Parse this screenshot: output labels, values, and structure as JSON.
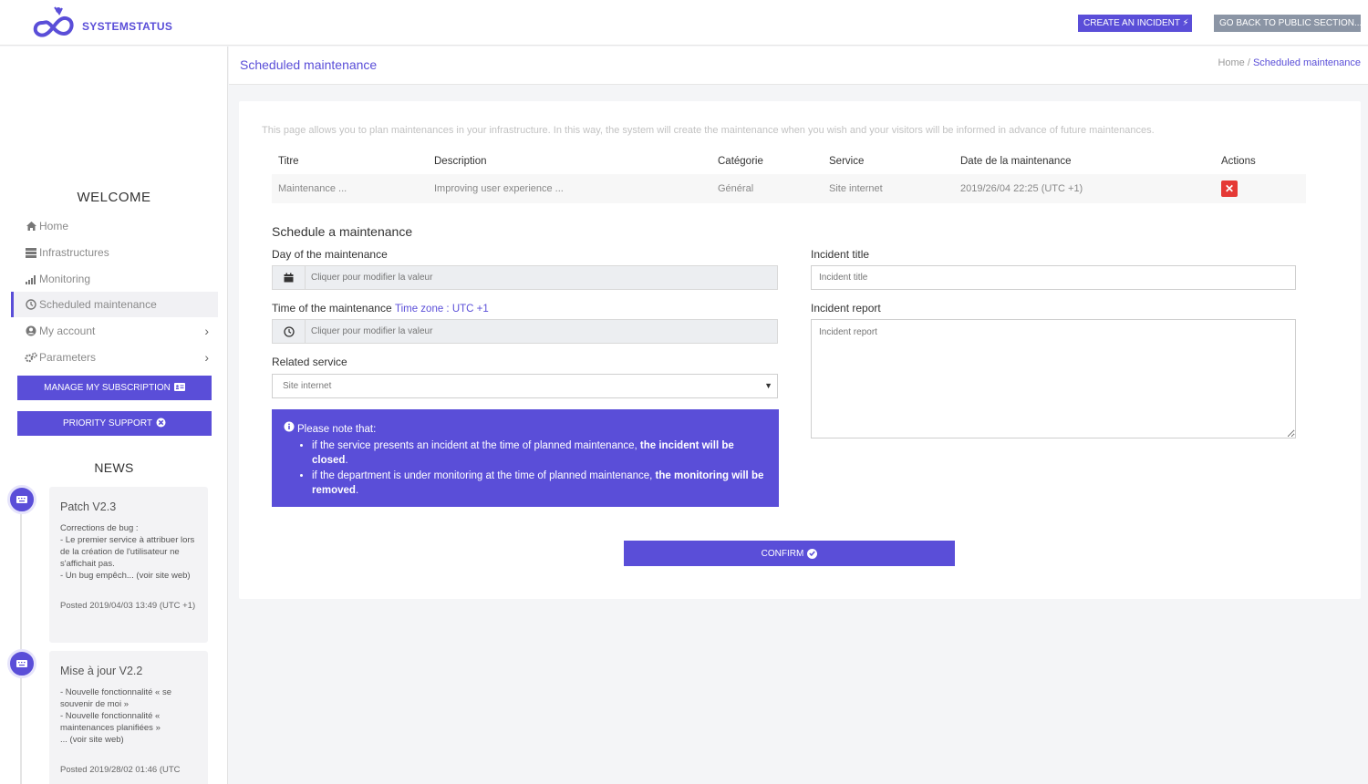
{
  "header": {
    "brand": "SYSTEMSTATUS",
    "create_incident": "CREATE AN INCIDENT",
    "back_public": "GO BACK TO PUBLIC SECTION..."
  },
  "sidebar": {
    "welcome": "WELCOME",
    "items": [
      {
        "label": "Home",
        "icon": "home-icon"
      },
      {
        "label": "Infrastructures",
        "icon": "server-icon"
      },
      {
        "label": "Monitoring",
        "icon": "signal-icon"
      },
      {
        "label": "Scheduled maintenance",
        "icon": "clock-icon",
        "active": true
      },
      {
        "label": "My account",
        "icon": "user-circle-icon"
      },
      {
        "label": "Parameters",
        "icon": "gears-icon"
      }
    ],
    "manage_subscription": "MANAGE MY SUBSCRIPTION",
    "priority_support": "PRIORITY SUPPORT",
    "news_title": "NEWS",
    "news": [
      {
        "title": "Patch V2.3",
        "body_lines": [
          "Corrections de bug :",
          "- Le premier service à attribuer lors de la création de l'utilisateur ne s'affichait pas.",
          "- Un bug empêch... (voir site web)"
        ],
        "posted": "Posted 2019/04/03 13:49 (UTC +1)"
      },
      {
        "title": "Mise à jour V2.2",
        "body_lines": [
          "- Nouvelle fonctionnalité « se souvenir de moi »",
          "- Nouvelle fonctionnalité « maintenances planifiées »",
          "... (voir site web)"
        ],
        "posted": "Posted 2019/28/02 01:46 (UTC"
      }
    ]
  },
  "content": {
    "page_title": "Scheduled maintenance",
    "breadcrumb_home": "Home",
    "breadcrumb_sep": " / ",
    "breadcrumb_current": "Scheduled maintenance",
    "intro": "This page allows you to plan maintenances in your infrastructure. In this way, the system will create the maintenance when you wish and your visitors will be informed in advance of future maintenances.",
    "table": {
      "headers": [
        "Titre",
        "Description",
        "Catégorie",
        "Service",
        "Date de la maintenance",
        "Actions"
      ],
      "rows": [
        {
          "titre": "Maintenance ...",
          "description": "Improving user experience ...",
          "categorie": "Général",
          "service": "Site internet",
          "date": "2019/26/04 22:25 (UTC +1)"
        }
      ]
    },
    "form": {
      "title": "Schedule a maintenance",
      "day_label": "Day of the maintenance",
      "day_placeholder": "Cliquer pour modifier la valeur",
      "time_label": "Time of the maintenance",
      "timezone": "Time zone : UTC +1",
      "time_placeholder": "Cliquer pour modifier la valeur",
      "service_label": "Related service",
      "service_value": "Site internet",
      "incident_title_label": "Incident title",
      "incident_title_placeholder": "Incident title",
      "incident_report_label": "Incident report",
      "incident_report_placeholder": "Incident report",
      "note_head": "Please note that:",
      "note_1_pre": "if the service presents an incident at the time of planned maintenance, ",
      "note_1_bold": "the incident will be closed",
      "note_1_post": ".",
      "note_2_pre": "if the department is under monitoring at the time of planned maintenance, ",
      "note_2_bold": "the monitoring will be removed",
      "note_2_post": ".",
      "confirm": "CONFIRM"
    }
  },
  "colors": {
    "accent": "#5a4ed8",
    "danger": "#e53935",
    "muted_button": "#8b95a5"
  }
}
